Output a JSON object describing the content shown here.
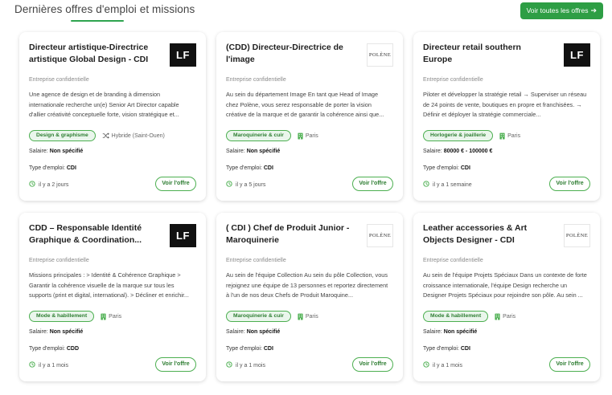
{
  "header": {
    "title": "Dernières offres d'emploi et missions",
    "view_all": "Voir toutes les offres",
    "view_all_icon": "arrow-right-icon",
    "accent_color": "#2e9e45"
  },
  "labels": {
    "salary": "Salaire:",
    "type": "Type d'emploi:",
    "button": "Voir l'offre"
  },
  "jobs": [
    {
      "title": "Directeur artistique-Directrice artistique Global Design - CDI",
      "logo": "LF",
      "company": "Entreprise confidentielle",
      "description": "Une agence de design et de branding à dimension internationale recherche un(e) Senior Art Director capable d'allier créativité conceptuelle forte, vision stratégique et...",
      "tag": "Design & graphisme",
      "location": "Hybride (Saint-Ouen)",
      "location_icon": "shuffle-icon",
      "salary": "Non spécifié",
      "type": "CDI",
      "posted": "il y a 2 jours"
    },
    {
      "title": "(CDD) Directeur-Directrice de l'image",
      "logo": "POLÈNE",
      "company": "Entreprise confidentielle",
      "description": "Au sein du département Image En tant que Head of Image chez Polène, vous serez responsable de porter la vision créative de la marque et de garantir la cohérence ainsi que...",
      "tag": "Maroquinerie & cuir",
      "location": "Paris",
      "location_icon": "building-icon",
      "salary": "Non spécifié",
      "type": "CDI",
      "posted": "il y a 5 jours"
    },
    {
      "title": "Directeur retail southern Europe",
      "logo": "LF",
      "company": "Entreprise confidentielle",
      "description": "Piloter et développer la stratégie retail → Superviser un réseau de 24 points de vente, boutiques en propre et franchisées. → Définir et déployer la stratégie commerciale...",
      "tag": "Horlogerie & joaillerie",
      "location": "Paris",
      "location_icon": "building-icon",
      "salary": "80000 € - 100000 €",
      "type": "CDI",
      "posted": "il y a 1 semaine"
    },
    {
      "title": "CDD – Responsable Identité Graphique & Coordination...",
      "logo": "LF",
      "company": "Entreprise confidentielle",
      "description": "Missions principales : > Identité & Cohérence Graphique > Garantir la cohérence visuelle de la marque sur tous les supports (print et digital, international). > Décliner et enrichir...",
      "tag": "Mode & habillement",
      "location": "Paris",
      "location_icon": "building-icon",
      "salary": "Non spécifié",
      "type": "CDD",
      "posted": "il y a 1 mois"
    },
    {
      "title": "( CDI ) Chef de Produit Junior - Maroquinerie",
      "logo": "POLÈNE",
      "company": "Entreprise confidentielle",
      "description": "Au sein de l'équipe Collection Au sein du pôle Collection, vous rejoignez une équipe de 13 personnes et reportez directement à l'un de nos deux Chefs de Produit Maroquine...",
      "tag": "Maroquinerie & cuir",
      "location": "Paris",
      "location_icon": "building-icon",
      "salary": "Non spécifié",
      "type": "CDI",
      "posted": "il y a 1 mois"
    },
    {
      "title": "Leather accessories & Art Objects Designer - CDI",
      "logo": "POLÈNE",
      "company": "Entreprise confidentielle",
      "description": "Au sein de l'équipe Projets Spéciaux Dans un contexte de forte croissance internationale, l'équipe Design recherche un Designer Projets Spéciaux pour rejoindre son pôle. Au sein ...",
      "tag": "Mode & habillement",
      "location": "Paris",
      "location_icon": "building-icon",
      "salary": "Non spécifié",
      "type": "CDI",
      "posted": "il y a 1 mois"
    }
  ]
}
